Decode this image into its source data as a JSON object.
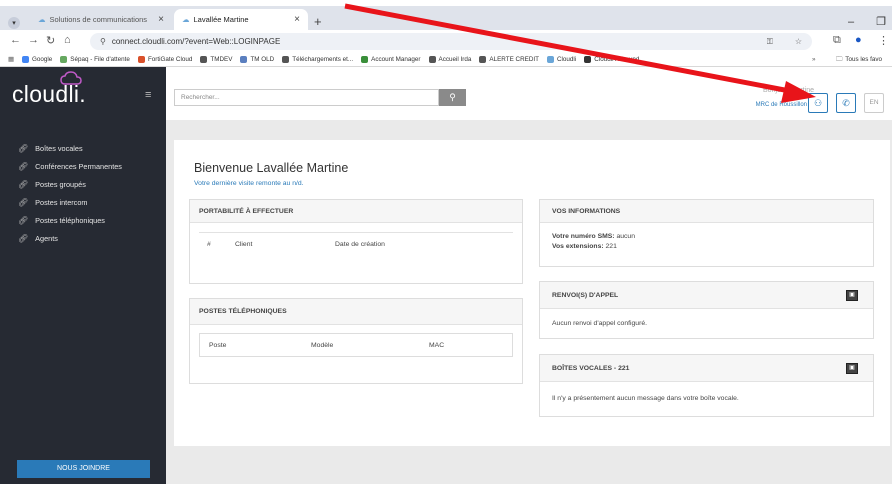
{
  "browser": {
    "tabs": [
      {
        "label": "Solutions de communications"
      },
      {
        "label": "Lavallée Martine"
      }
    ],
    "url": "connect.cloudli.com/?event=Web::LOGINPAGE",
    "bookmarks": [
      "Google",
      "Sépaq - File d'attente",
      "FortiGate Cloud",
      "TMDEV",
      "TM OLD",
      "Téléchargements et...",
      "Account Manager",
      "Accueil Irda",
      "ALERTE CREDIT",
      "Cloudli",
      "Cloudli Allbound"
    ],
    "bookmarks_folder": "Tous les favo"
  },
  "app": {
    "logo": "cloudli.",
    "sidebar": {
      "items": [
        {
          "label": "Boîtes vocales"
        },
        {
          "label": "Conférences Permanentes"
        },
        {
          "label": "Postes groupés"
        },
        {
          "label": "Postes intercom"
        },
        {
          "label": "Postes téléphoniques"
        },
        {
          "label": "Agents"
        }
      ],
      "join_button": "NOUS JOINDRE"
    },
    "header": {
      "search_placeholder": "Rechercher...",
      "greeting": "Bonjour, Martine",
      "organization": "MRC de Roussillon",
      "lang_button": "EN"
    },
    "main": {
      "welcome": "Bienvenue Lavallée Martine",
      "last_visit": "Votre dernière visite remonte au n/d.",
      "portability": {
        "title": "PORTABILITÉ À EFFECTUER",
        "columns": [
          "#",
          "Client",
          "Date de création"
        ]
      },
      "phones": {
        "title": "POSTES TÉLÉPHONIQUES",
        "columns": [
          "Poste",
          "Modèle",
          "MAC"
        ]
      },
      "info": {
        "title": "VOS INFORMATIONS",
        "sms_label": "Votre numéro SMS:",
        "sms_value": "aucun",
        "ext_label": "Vos extensions:",
        "ext_value": "221"
      },
      "forwarding": {
        "title": "RENVOI(S) D'APPEL",
        "message": "Aucun renvoi d'appel configuré."
      },
      "voicemail": {
        "title": "BOÎTES VOCALES - 221",
        "message": "Il n'y a présentement aucun message dans votre boîte vocale."
      }
    }
  },
  "colors": {
    "accent": "#2a7ab8",
    "sidebar": "#262a33",
    "arrow": "#e8141a"
  }
}
